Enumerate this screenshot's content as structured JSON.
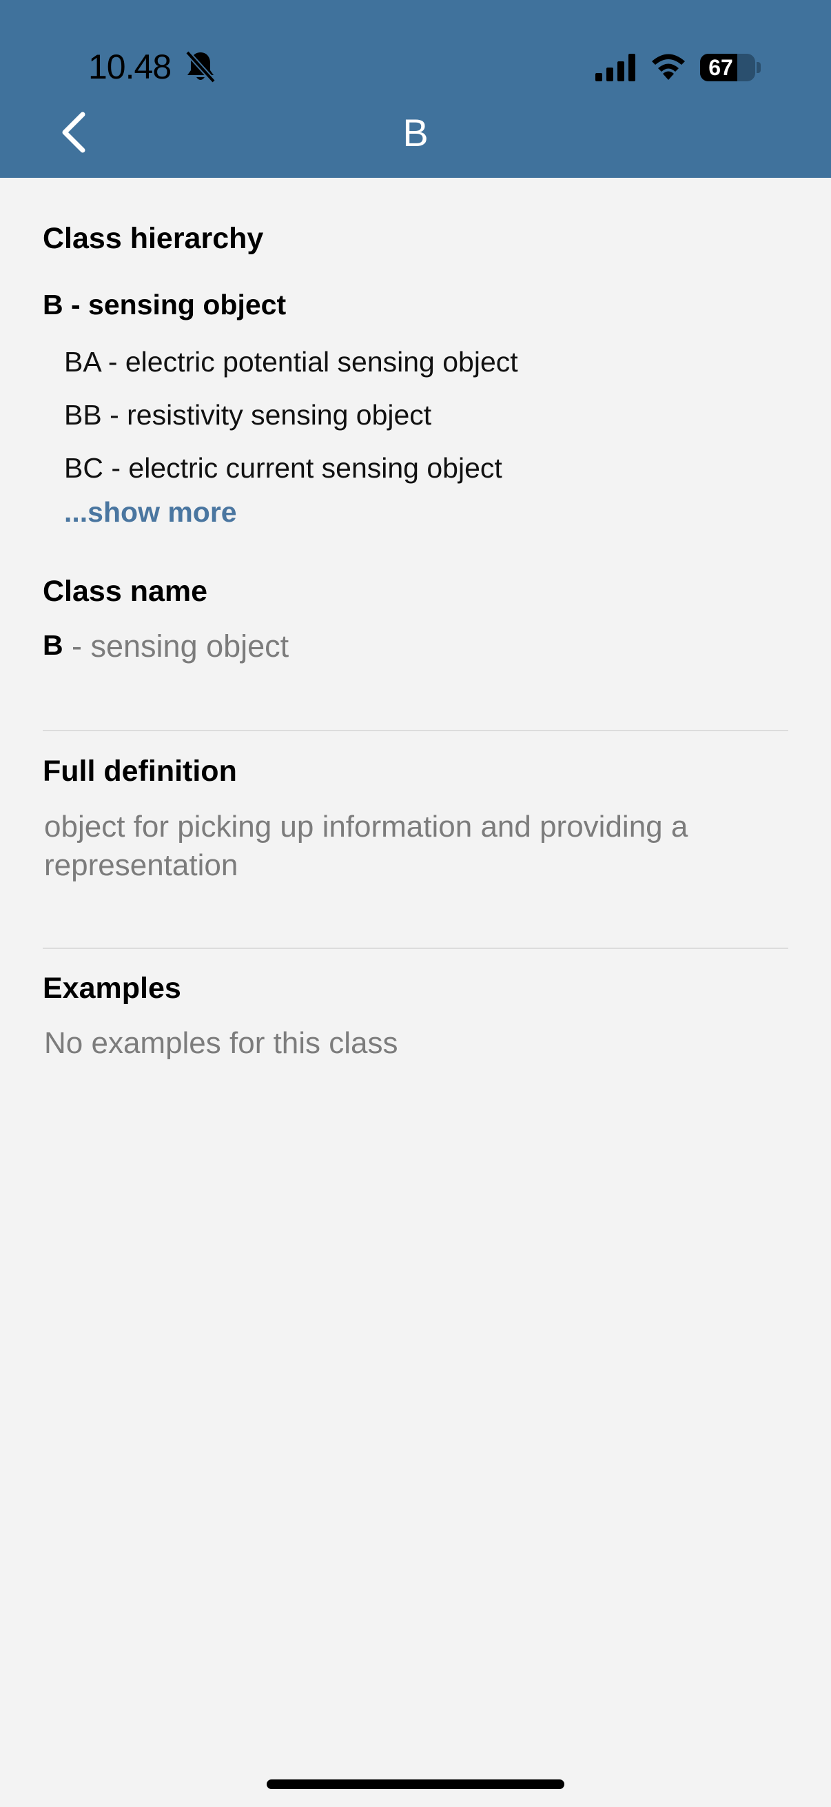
{
  "status_bar": {
    "time": "10.48",
    "battery": "67",
    "battery_level": 0.67,
    "icons": [
      "bell-slash-icon",
      "signal-icon",
      "wifi-icon",
      "battery-icon"
    ]
  },
  "nav": {
    "title": "B",
    "back_icon": "chevron-left-icon"
  },
  "colors": {
    "header": "#40729c",
    "background": "#f3f3f3",
    "link": "#4a76a0",
    "muted_text": "#7c7c7c"
  },
  "hierarchy": {
    "title": "Class hierarchy",
    "parent": "B - sensing object",
    "children": [
      "BA - electric potential sensing object",
      "BB - resistivity sensing object",
      "BC - electric current sensing object"
    ],
    "show_more": "...show more"
  },
  "class_name": {
    "title": "Class name",
    "code": "B",
    "text": "- sensing object"
  },
  "definition": {
    "title": "Full definition",
    "text": "object for picking up information and providing a representation"
  },
  "examples": {
    "title": "Examples",
    "text": "No examples for this class"
  }
}
